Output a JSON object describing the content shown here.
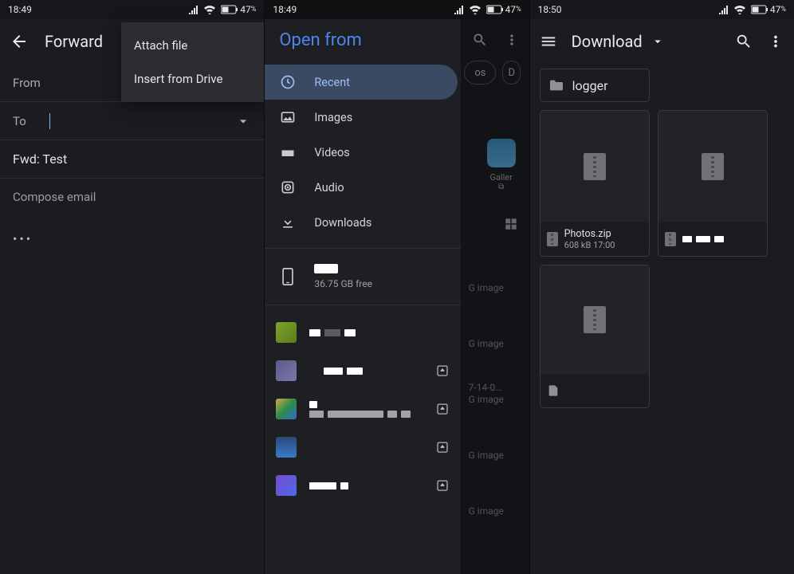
{
  "status": {
    "p1_time": "18:49",
    "p2_time": "18:49",
    "p3_time": "18:50",
    "battery": "47",
    "battery_suffix": "%"
  },
  "p1": {
    "title": "Forward",
    "menu": {
      "attach": "Attach file",
      "drive": "Insert from Drive"
    },
    "from_label": "From",
    "to_label": "To",
    "subject": "Fwd: Test",
    "compose_placeholder": "Compose email",
    "ellipsis": "•••"
  },
  "p2": {
    "title": "Open from",
    "items": {
      "recent": "Recent",
      "images": "Images",
      "videos": "Videos",
      "audio": "Audio",
      "downloads": "Downloads"
    },
    "device_free": "36.75 GB free",
    "behind": {
      "gallery_label": "Galler",
      "gimage": "G image",
      "partial_date": "7-14-0…"
    }
  },
  "p3": {
    "title": "Download",
    "folder": "logger",
    "file1": {
      "name": "Photos.zip",
      "meta": "608 kB 17:00"
    }
  }
}
